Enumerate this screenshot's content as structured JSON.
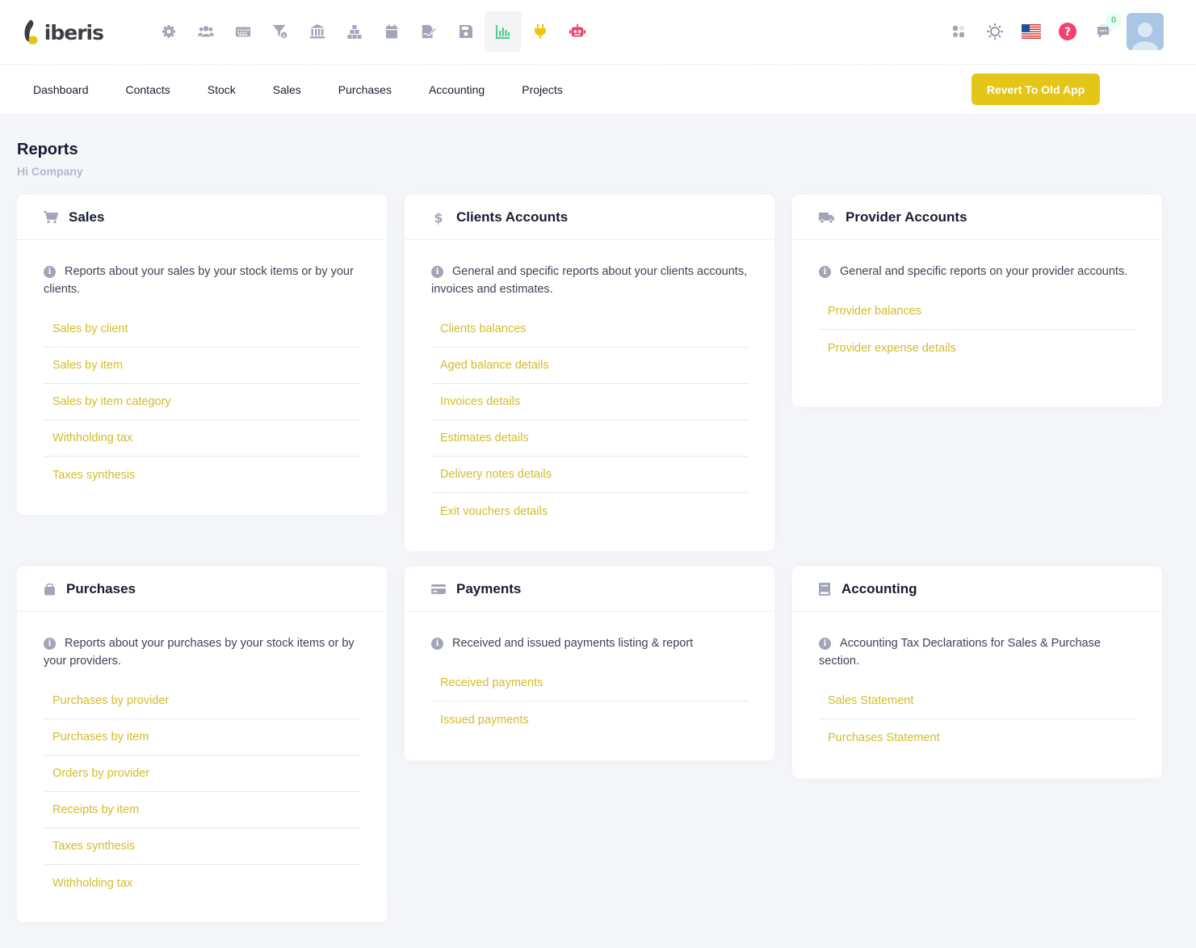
{
  "brand": {
    "name": "iberis"
  },
  "topbar": {
    "modules": [
      {
        "icon": "gear-icon",
        "color": "#a1a5b7",
        "active": false
      },
      {
        "icon": "users-icon",
        "color": "#a1a5b7",
        "active": false
      },
      {
        "icon": "keyboard-icon",
        "color": "#a1a5b7",
        "active": false
      },
      {
        "icon": "funnel-dollar-icon",
        "color": "#a1a5b7",
        "active": false
      },
      {
        "icon": "bank-icon",
        "color": "#a1a5b7",
        "active": false
      },
      {
        "icon": "boxes-icon",
        "color": "#a1a5b7",
        "active": false
      },
      {
        "icon": "calendar-icon",
        "color": "#a1a5b7",
        "active": false
      },
      {
        "icon": "file-signature-icon",
        "color": "#a1a5b7",
        "active": false
      },
      {
        "icon": "floppy-disk-icon",
        "color": "#a1a5b7",
        "active": false
      },
      {
        "icon": "chart-bar-icon",
        "color": "#50cd89",
        "active": true
      },
      {
        "icon": "plug-icon",
        "color": "#f1c40f",
        "active": false
      },
      {
        "icon": "robot-icon",
        "color": "#f1416c",
        "active": false
      }
    ],
    "notifications_count": "0"
  },
  "nav": {
    "items": [
      "Dashboard",
      "Contacts",
      "Stock",
      "Sales",
      "Purchases",
      "Accounting",
      "Projects"
    ],
    "revert_label": "Revert To Old App"
  },
  "page": {
    "title": "Reports",
    "subtitle": "Hi Company"
  },
  "colors": {
    "accent": "#e4c619",
    "link": "#d4bc2a",
    "active_module": "#50cd89"
  },
  "cards": [
    {
      "icon": "cart-icon",
      "title": "Sales",
      "description": "Reports about your sales by your stock items or by your clients.",
      "links": [
        "Sales by client",
        "Sales by item",
        "Sales by item category",
        "Withholding tax",
        "Taxes synthesis"
      ]
    },
    {
      "icon": "dollar-icon",
      "title": "Clients Accounts",
      "description": "General and specific reports about your clients accounts, invoices and estimates.",
      "links": [
        "Clients balances",
        "Aged balance details",
        "Invoices details",
        "Estimates details",
        "Delivery notes details",
        "Exit vouchers details"
      ]
    },
    {
      "icon": "truck-icon",
      "title": "Provider Accounts",
      "description": "General and specific reports on your provider accounts.",
      "links": [
        "Provider balances",
        "Provider expense details"
      ]
    },
    {
      "icon": "shopping-bag-icon",
      "title": "Purchases",
      "description": "Reports about your purchases by your stock items or by your providers.",
      "links": [
        "Purchases by provider",
        "Purchases by item",
        "Orders by provider",
        "Receipts by item",
        "Taxes synthesis",
        "Withholding tax"
      ]
    },
    {
      "icon": "credit-card-icon",
      "title": "Payments",
      "description": "Received and issued payments listing & report",
      "links": [
        "Received payments",
        "Issued payments"
      ]
    },
    {
      "icon": "book-icon",
      "title": "Accounting",
      "description": "Accounting Tax Declarations for Sales & Purchase section.",
      "links": [
        "Sales Statement",
        "Purchases Statement"
      ]
    }
  ]
}
